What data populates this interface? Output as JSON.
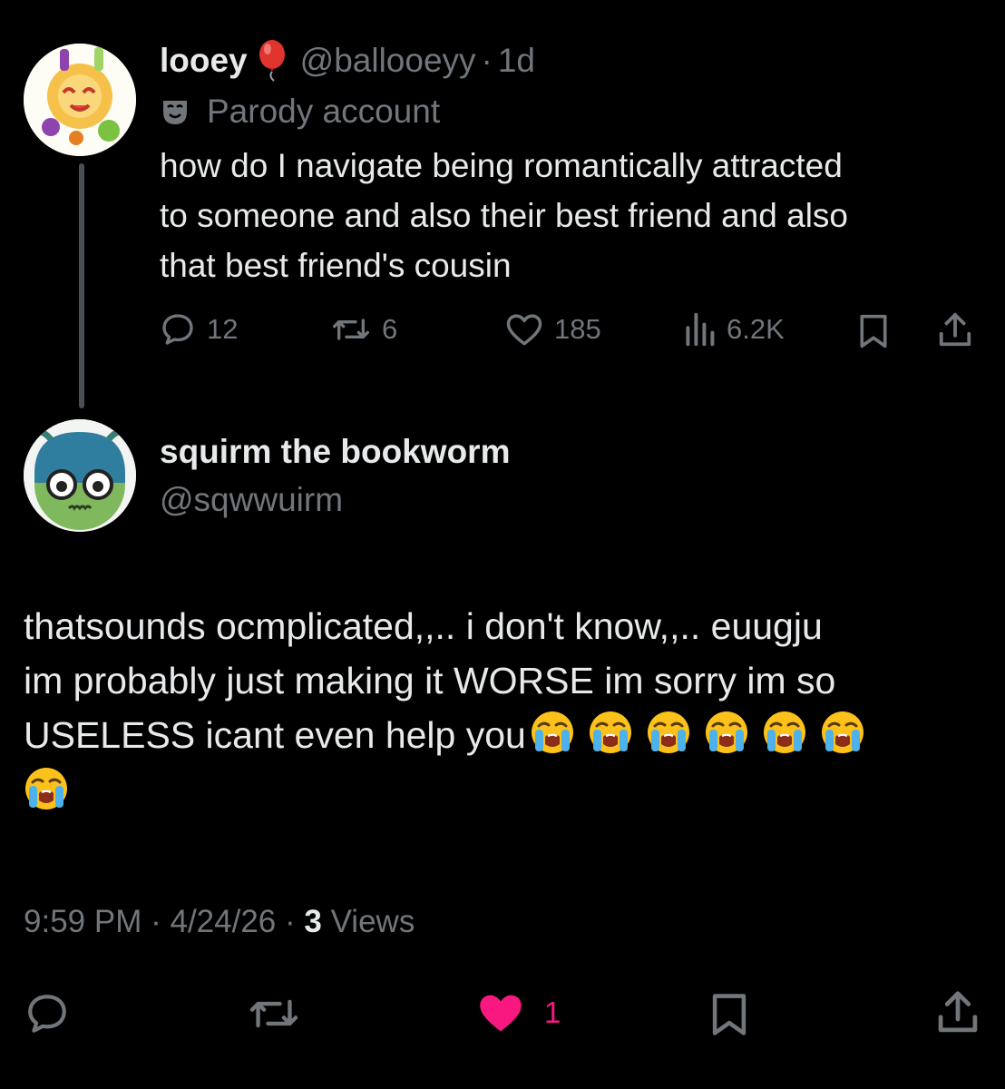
{
  "colors": {
    "background": "#000000",
    "text": "#e7e9ea",
    "muted": "#71767b",
    "like_active": "#f91880"
  },
  "parent_tweet": {
    "display_name": "looey",
    "name_emoji": "balloon-icon",
    "handle": "@ballooeyy",
    "separator": "·",
    "age": "1d",
    "label": "Parody account",
    "label_icon": "parody-mask-icon",
    "text_lines": [
      "how do I navigate being romantically attracted",
      "to someone and also their best friend and also",
      "that best friend's cousin"
    ],
    "stats": {
      "replies": "12",
      "reposts": "6",
      "likes": "185",
      "views": "6.2K"
    }
  },
  "reply_tweet": {
    "display_name": "squirm the bookworm",
    "handle": "@sqwwuirm",
    "text_lines": [
      "thatsounds ocmplicated,,.. i don't know,,.. euugju",
      "im probably just making it WORSE im sorry im so",
      "USELESS icant even help you"
    ],
    "emoji_name": "loudly-crying-face-icon",
    "emoji_count_line3": 6,
    "emoji_count_line4": 1,
    "timestamp": {
      "time": "9:59 PM",
      "separator": "·",
      "date": "4/24/26",
      "views_count": "3",
      "views_label": "Views"
    },
    "actions": {
      "like_count": "1",
      "liked": true
    }
  }
}
